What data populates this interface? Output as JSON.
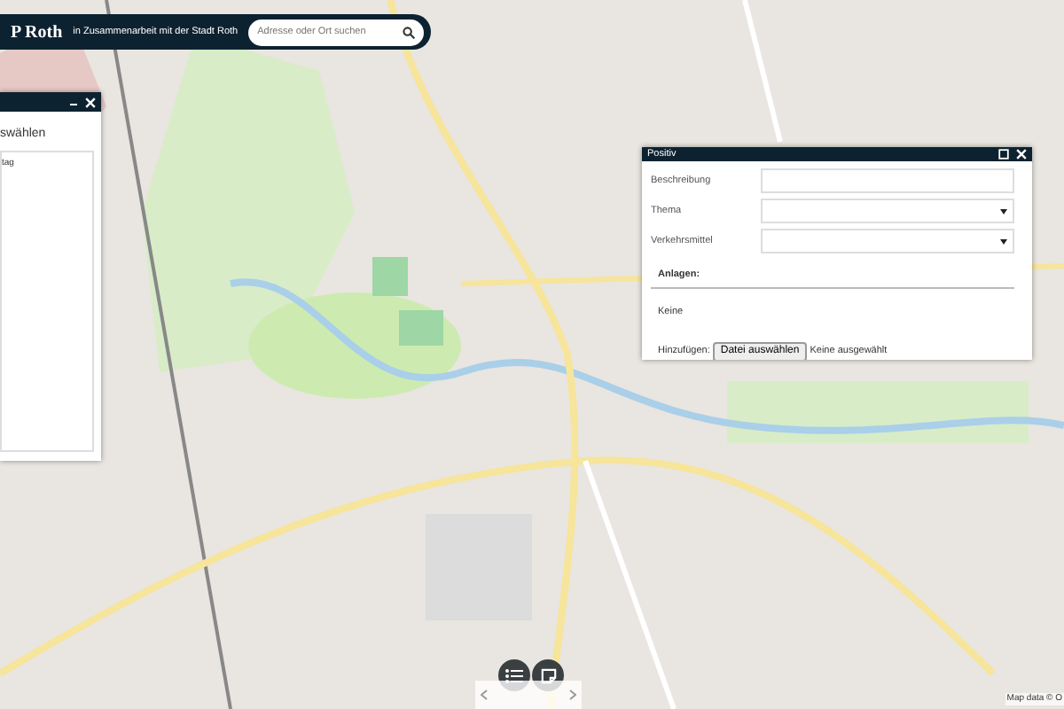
{
  "header": {
    "brand": "P Roth",
    "subtitle": "in Zusammenarbeit mit der Stadt Roth",
    "search": {
      "placeholder": "Adresse oder Ort suchen"
    }
  },
  "left_panel": {
    "heading": "swählen",
    "item": "tag"
  },
  "form_dialog": {
    "title": "Positiv",
    "fields": [
      {
        "label": "Beschreibung",
        "kind": "text"
      },
      {
        "label": "Thema",
        "kind": "select"
      },
      {
        "label": "Verkehrsmittel",
        "kind": "select"
      }
    ],
    "attachments": {
      "heading": "Anlagen:",
      "empty": "Keine",
      "add_label": "Hinzufügen:",
      "file_button": "Datei auswählen",
      "file_status": "Keine ausgewählt"
    }
  },
  "attribution": "Map data © O"
}
